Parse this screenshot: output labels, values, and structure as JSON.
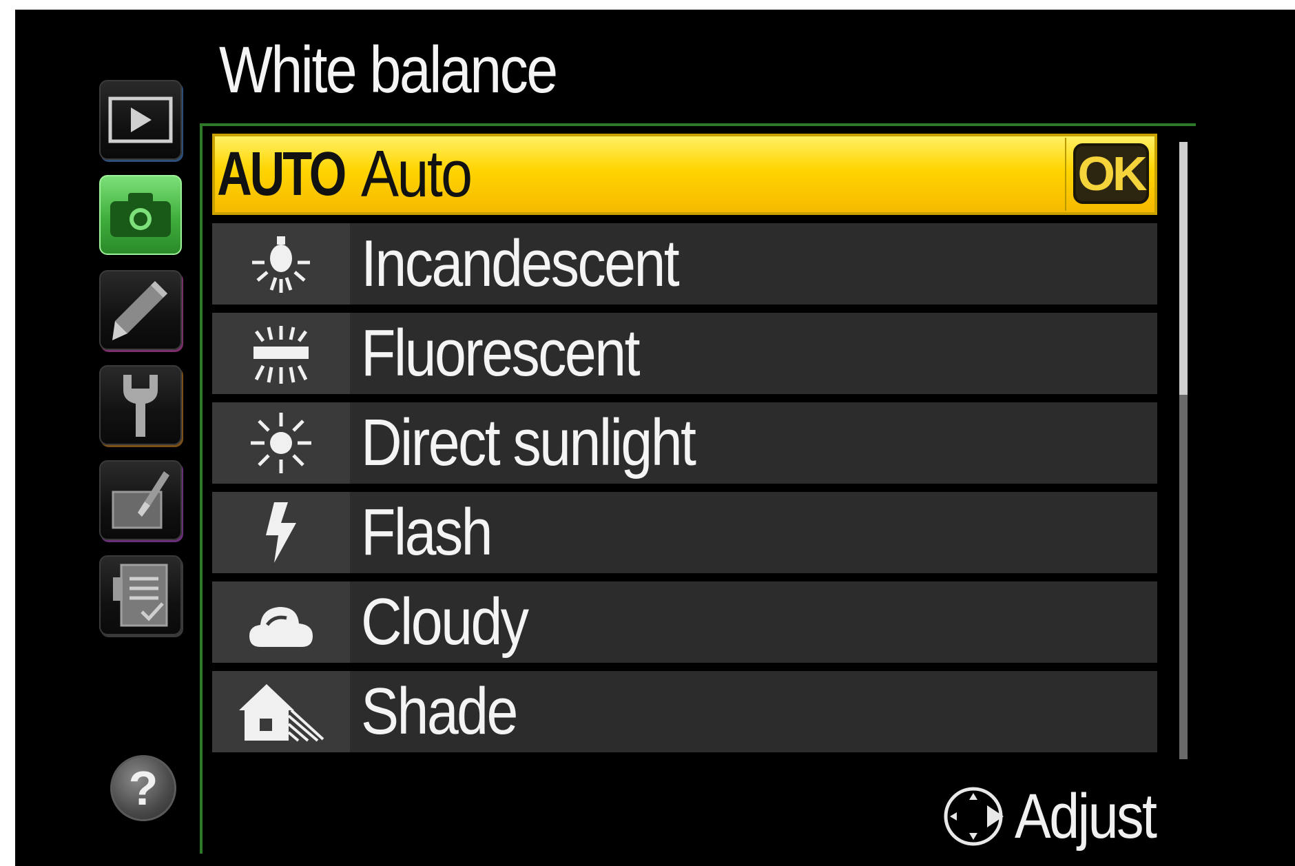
{
  "title": "White balance",
  "tabs": [
    {
      "name": "playback-menu-tab",
      "icon": "play-icon"
    },
    {
      "name": "shooting-menu-tab",
      "icon": "camera-icon",
      "active": true
    },
    {
      "name": "custom-settings-tab",
      "icon": "pencil-icon"
    },
    {
      "name": "setup-menu-tab",
      "icon": "wrench-icon"
    },
    {
      "name": "retouch-menu-tab",
      "icon": "retouch-brush-icon"
    },
    {
      "name": "recent-settings-tab",
      "icon": "clipboard-check-icon"
    }
  ],
  "help": {
    "label": "?"
  },
  "options": [
    {
      "icon": "auto-icon",
      "icon_text": "AUTO",
      "label": "Auto",
      "selected": true,
      "badge": "OK"
    },
    {
      "icon": "incandescent-bulb-icon",
      "label": "Incandescent"
    },
    {
      "icon": "fluorescent-icon",
      "label": "Fluorescent"
    },
    {
      "icon": "sun-icon",
      "label": "Direct sunlight"
    },
    {
      "icon": "flash-icon",
      "label": "Flash"
    },
    {
      "icon": "cloud-icon",
      "label": "Cloudy"
    },
    {
      "icon": "shade-house-icon",
      "label": "Shade"
    }
  ],
  "scrollbar": {
    "visible_fraction": 0.41
  },
  "footer": {
    "action_icon": "multi-selector-right-icon",
    "action_label": "Adjust"
  },
  "colors": {
    "selected_yellow": "#ffd400",
    "active_tab_green": "#3fae3c",
    "row_bg": "#2c2c2c",
    "icon_cell_bg": "#3a3a3a",
    "ok_text": "#f4d43a"
  }
}
